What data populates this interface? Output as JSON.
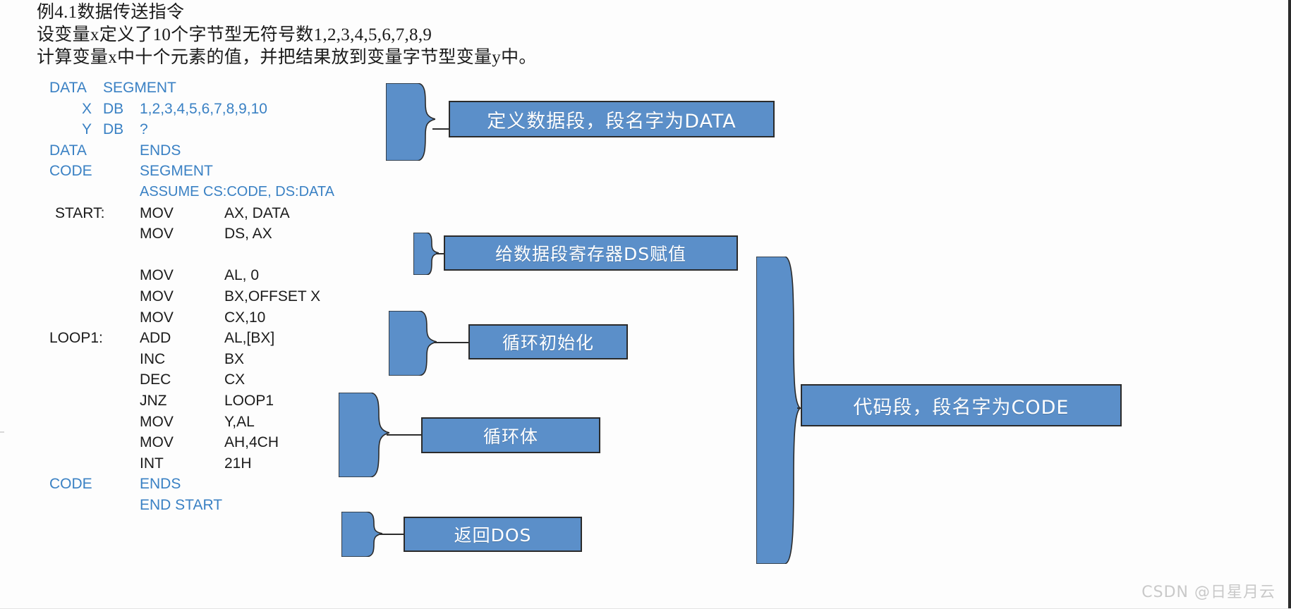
{
  "header": {
    "line1": "例4.1数据传送指令",
    "line2": "设变量x定义了10个字节型无符号数1,2,3,4,5,6,7,8,9",
    "line3": "计算变量x中十个元素的值，并把结果放到变量字节型变量y中。"
  },
  "code": {
    "rows": [
      {
        "label": "DATA",
        "op": "SEGMENT",
        "arg": ""
      },
      {
        "label": "X",
        "op": "DB",
        "arg": "1,2,3,4,5,6,7,8,9,10"
      },
      {
        "label": "Y",
        "op": "DB",
        "arg": "?"
      },
      {
        "label": "DATA",
        "op": "ENDS",
        "arg": ""
      },
      {
        "label": "CODE",
        "op": "SEGMENT",
        "arg": ""
      },
      {
        "label": "",
        "op": "ASSUME CS:CODE, DS:DATA",
        "arg": ""
      },
      {
        "label": "START:",
        "op": "MOV",
        "arg": "AX, DATA"
      },
      {
        "label": "",
        "op": "MOV",
        "arg": "DS, AX"
      },
      {
        "label": "",
        "op": "",
        "arg": ""
      },
      {
        "label": "",
        "op": "MOV",
        "arg": "AL, 0"
      },
      {
        "label": "",
        "op": "MOV",
        "arg": "BX,OFFSET X"
      },
      {
        "label": "",
        "op": "MOV",
        "arg": "CX,10"
      },
      {
        "label": "LOOP1:",
        "op": "ADD",
        "arg": "AL,[BX]"
      },
      {
        "label": "",
        "op": "INC",
        "arg": "BX"
      },
      {
        "label": "",
        "op": "DEC",
        "arg": "CX"
      },
      {
        "label": "",
        "op": "JNZ",
        "arg": "LOOP1"
      },
      {
        "label": "",
        "op": "MOV",
        "arg": "Y,AL"
      },
      {
        "label": "",
        "op": "MOV",
        "arg": "AH,4CH"
      },
      {
        "label": "",
        "op": "INT",
        "arg": "21H"
      },
      {
        "label": "CODE",
        "op": "ENDS",
        "arg": ""
      },
      {
        "label": "",
        "op": "END START",
        "arg": ""
      }
    ]
  },
  "callouts": {
    "data_segment": "定义数据段，段名字为DATA",
    "ds_init": "给数据段寄存器DS赋值",
    "loop_init": "循环初始化",
    "loop_body": "循环体",
    "return_dos": "返回DOS",
    "code_segment": "代码段，段名字为CODE"
  },
  "colors": {
    "keyword_blue": "#3a81c4",
    "callout_fill": "#5b8fc9",
    "callout_border": "#2b2b2b",
    "brace_fill": "#5b8fc9",
    "text_dark": "#1b1b1b"
  },
  "watermark": "CSDN @日星月云"
}
